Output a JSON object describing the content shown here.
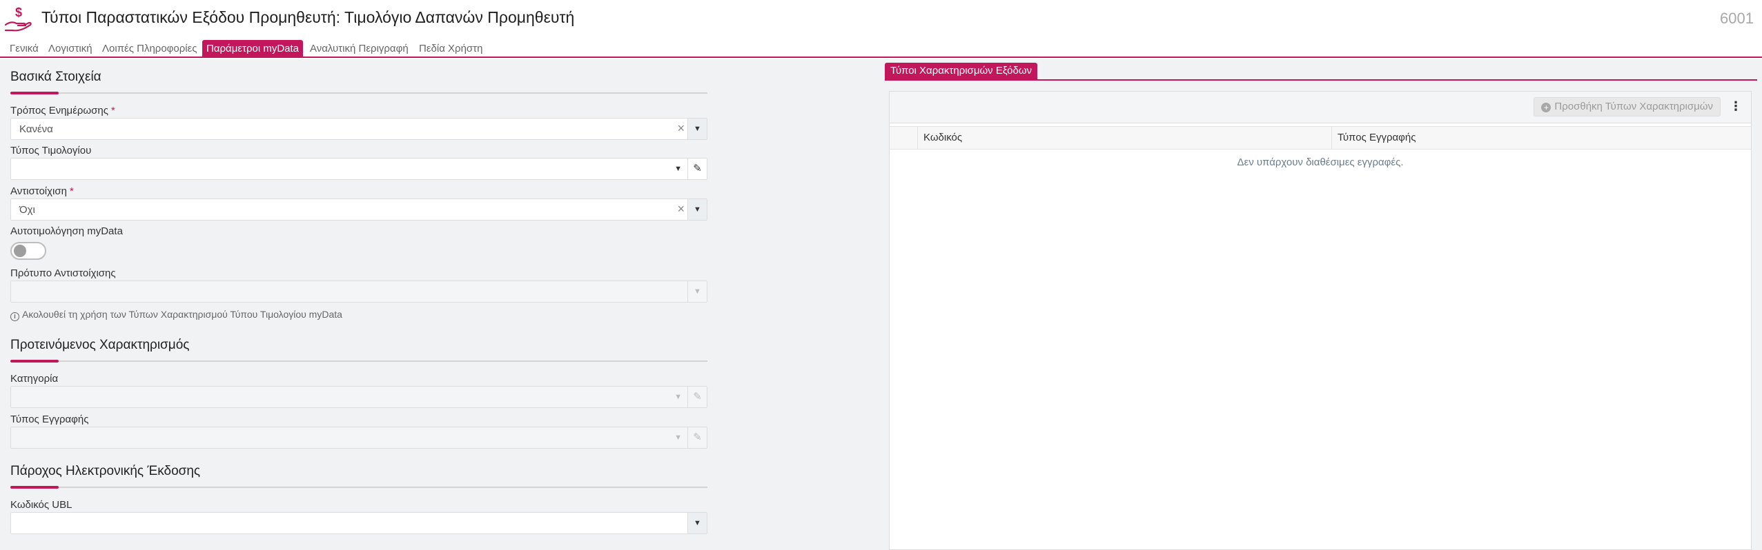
{
  "header": {
    "title": "Τύποι Παραστατικών Εξόδου Προμηθευτή: Τιμολόγιο Δαπανών Προμηθευτή",
    "code": "6001"
  },
  "tabs": [
    {
      "label": "Γενικά",
      "active": false
    },
    {
      "label": "Λογιστική",
      "active": false
    },
    {
      "label": "Λοιπές Πληροφορίες",
      "active": false
    },
    {
      "label": "Παράμετροι myData",
      "active": true
    },
    {
      "label": "Αναλυτική Περιγραφή",
      "active": false
    },
    {
      "label": "Πεδία Χρήστη",
      "active": false
    }
  ],
  "sections": {
    "basic": {
      "title": "Βασικά Στοιχεία",
      "update_mode": {
        "label": "Τρόπος Ενημέρωσης",
        "required_mark": "*",
        "value": "Κανένα"
      },
      "invoice_type": {
        "label": "Τύπος Τιμολογίου",
        "value": ""
      },
      "mapping": {
        "label": "Αντιστοίχιση",
        "required_mark": "*",
        "value": "Όχι"
      },
      "auto_invoicing": {
        "label": "Αυτοτιμολόγηση myData",
        "checked": false
      },
      "mapping_template": {
        "label": "Πρότυπο Αντιστοίχισης",
        "value": ""
      },
      "hint": "Ακολουθεί τη χρήση των Τύπων Χαρακτηρισμού Τύπου Τιμολογίου myData"
    },
    "suggested": {
      "title": "Προτεινόμενος Χαρακτηρισμός",
      "category": {
        "label": "Κατηγορία",
        "value": ""
      },
      "entry_type": {
        "label": "Τύπος Εγγραφής",
        "value": ""
      }
    },
    "provider": {
      "title": "Πάροχος Ηλεκτρονικής Έκδοσης",
      "ubl_code": {
        "label": "Κωδικός UBL",
        "value": ""
      }
    }
  },
  "right_panel": {
    "tab_label": "Τύποι Χαρακτηρισμών Εξόδων",
    "add_button": "Προσθήκη Τύπων Χαρακτηρισμών",
    "columns": [
      "Κωδικός",
      "Τύπος Εγγραφής"
    ],
    "empty_message": "Δεν υπάρχουν διαθέσιμες εγγραφές."
  },
  "colors": {
    "accent": "#c2185b",
    "panel_bg": "#f1f2f3"
  }
}
